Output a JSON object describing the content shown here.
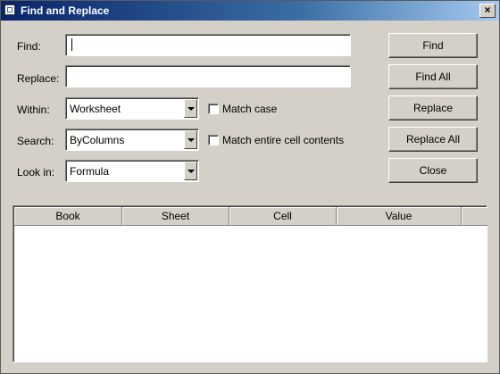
{
  "window": {
    "title": "Find and Replace",
    "close_glyph": "×"
  },
  "form": {
    "find_label": "Find:",
    "find_value": "",
    "replace_label": "Replace:",
    "replace_value": "",
    "within_label": "Within:",
    "within_value": "Worksheet",
    "search_label": "Search:",
    "search_value": "ByColumns",
    "lookin_label": "Look in:",
    "lookin_value": "Formula",
    "match_case_label": "Match case",
    "match_case_checked": false,
    "match_entire_label": "Match entire cell contents",
    "match_entire_checked": false
  },
  "buttons": {
    "find": "Find",
    "find_all": "Find All",
    "replace": "Replace",
    "replace_all": "Replace All",
    "close": "Close"
  },
  "results": {
    "columns": [
      "Book",
      "Sheet",
      "Cell",
      "Value",
      ""
    ],
    "rows": []
  }
}
